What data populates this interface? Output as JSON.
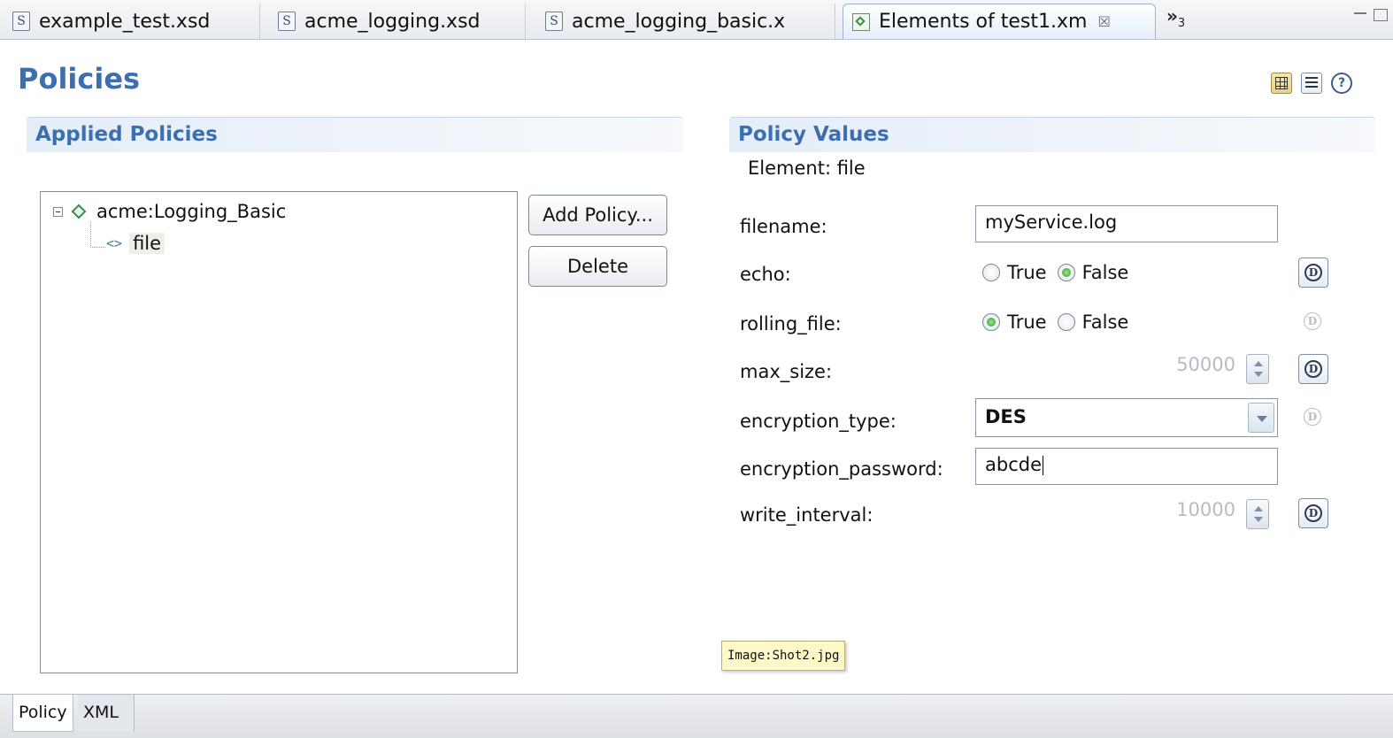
{
  "tabs": [
    {
      "label": "example_test.xsd",
      "icon": "schema-file-icon"
    },
    {
      "label": "acme_logging.xsd",
      "icon": "schema-file-icon"
    },
    {
      "label": "acme_logging_basic.x",
      "icon": "schema-file-icon"
    },
    {
      "label": "Elements of test1.xm",
      "icon": "elements-editor-icon",
      "active": true,
      "close": "☒"
    }
  ],
  "tab_overflow": {
    "symbol": "»",
    "count": "3"
  },
  "page": {
    "title": "Policies"
  },
  "applied": {
    "header": "Applied Policies",
    "tree": {
      "root_label": "acme:Logging_Basic",
      "child_label": "file"
    },
    "add_label": "Add Policy...",
    "delete_label": "Delete"
  },
  "values": {
    "header": "Policy Values",
    "element_line": "Element: file",
    "fields": {
      "filename": {
        "label": "filename:",
        "value": "myService.log"
      },
      "echo": {
        "label": "echo:",
        "true_label": "True",
        "false_label": "False",
        "selected": "False"
      },
      "rolling_file": {
        "label": "rolling_file:",
        "true_label": "True",
        "false_label": "False",
        "selected": "True"
      },
      "max_size": {
        "label": "max_size:",
        "value": "50000"
      },
      "encryption_type": {
        "label": "encryption_type:",
        "value": "DES"
      },
      "encryption_password": {
        "label": "encryption_password:",
        "value": "abcde"
      },
      "write_interval": {
        "label": "write_interval:",
        "value": "10000"
      }
    }
  },
  "tooltip": "Image:Shot2.jpg",
  "bottom_tabs": [
    {
      "label": "Policy",
      "active": true
    },
    {
      "label": "XML",
      "active": false
    }
  ],
  "colors": {
    "title": "#3c6fb0",
    "radio_selected": "#2f9a2a"
  }
}
